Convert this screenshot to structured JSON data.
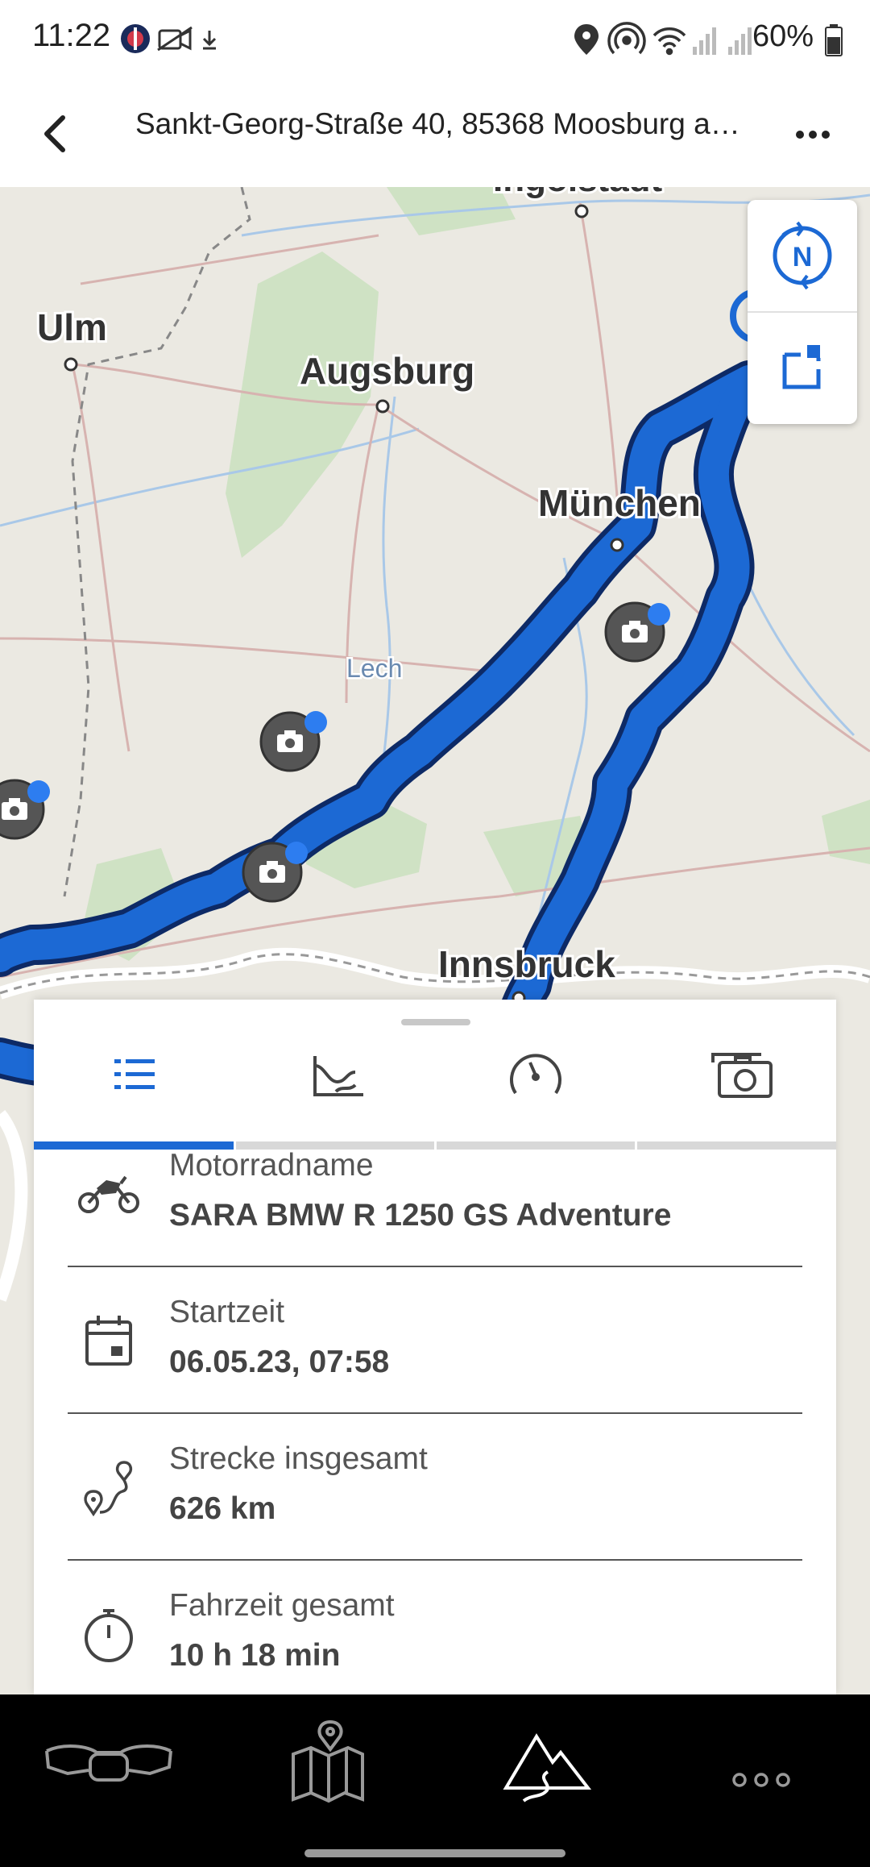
{
  "status_bar": {
    "time": "11:22",
    "battery_percent": "60%",
    "icons_left": [
      "app-icon",
      "camera-off-icon",
      "download-icon"
    ],
    "icons_right": [
      "location-icon",
      "hotspot-icon",
      "wifi-icon",
      "signal-icon",
      "signal-icon",
      "battery-icon"
    ]
  },
  "header": {
    "title": "Sankt-Georg-Straße 40, 85368 Moosburg an ...",
    "back_icon": "chevron-left-icon",
    "menu_icon": "more-horizontal-icon"
  },
  "map": {
    "labels": {
      "ingolstadt": "Ingolstadt",
      "ulm": "Ulm",
      "augsburg": "Augsburg",
      "muenchen": "München",
      "lech": "Lech",
      "innsbruck": "Innsbruck"
    },
    "controls": [
      "compass-north-icon",
      "route-focus-icon"
    ],
    "compass_letter": "N",
    "route_color": "#1c69d4",
    "photo_marker_count": 5
  },
  "panel": {
    "tabs": [
      "list-icon",
      "elevation-icon",
      "speedometer-icon",
      "camera-icon"
    ],
    "active_tab": 0,
    "rows": [
      {
        "icon": "motorcycle-icon",
        "label": "Motorradname",
        "value": "SARA BMW R 1250 GS Adventure"
      },
      {
        "icon": "calendar-icon",
        "label": "Startzeit",
        "value": "06.05.23, 07:58"
      },
      {
        "icon": "route-icon",
        "label": "Strecke insgesamt",
        "value": "626 km"
      },
      {
        "icon": "stopwatch-icon",
        "label": "Fahrzeit gesamt",
        "value": "10 h 18 min"
      }
    ]
  },
  "bottom_nav": {
    "items": [
      "motorcycle-dashboard-icon",
      "map-icon",
      "mountains-icon",
      "more-icon"
    ],
    "active": 2
  },
  "colors": {
    "accent": "#1c69d4",
    "nav_bg": "#000000"
  }
}
